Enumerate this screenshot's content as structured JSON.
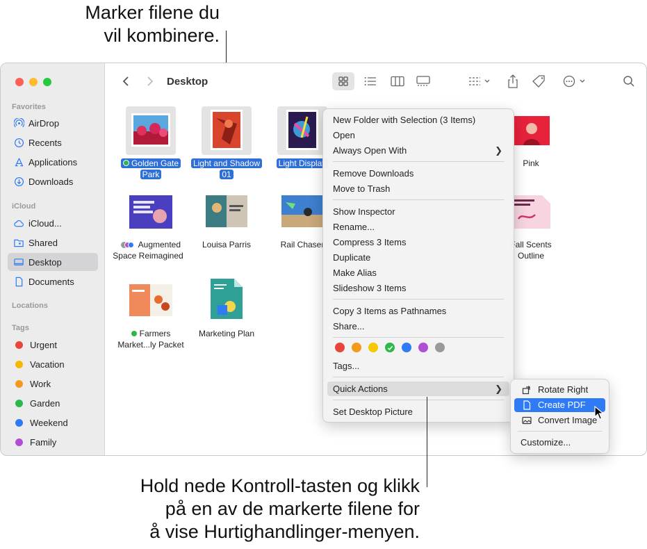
{
  "callouts": {
    "top_line1": "Marker filene du",
    "top_line2": "vil kombinere.",
    "bottom_line1": "Hold nede Kontroll-tasten og klikk",
    "bottom_line2": "på en av de markerte filene for",
    "bottom_line3": "å vise Hurtighandlinger-menyen."
  },
  "window": {
    "title": "Desktop"
  },
  "sidebar": {
    "favorites_header": "Favorites",
    "favorites": [
      {
        "label": "AirDrop",
        "icon": "airdrop-icon"
      },
      {
        "label": "Recents",
        "icon": "clock-icon"
      },
      {
        "label": "Applications",
        "icon": "applications-icon"
      },
      {
        "label": "Downloads",
        "icon": "download-icon"
      }
    ],
    "icloud_header": "iCloud",
    "icloud": [
      {
        "label": "iCloud...",
        "icon": "cloud-icon"
      },
      {
        "label": "Shared",
        "icon": "shared-folder-icon"
      },
      {
        "label": "Desktop",
        "icon": "desktop-icon",
        "selected": true
      },
      {
        "label": "Documents",
        "icon": "document-icon"
      }
    ],
    "locations_header": "Locations",
    "tags_header": "Tags",
    "tags": [
      {
        "label": "Urgent",
        "color": "#e8453c"
      },
      {
        "label": "Vacation",
        "color": "#f5b800"
      },
      {
        "label": "Work",
        "color": "#f39a1e"
      },
      {
        "label": "Garden",
        "color": "#2fb84a"
      },
      {
        "label": "Weekend",
        "color": "#2f7bf5"
      },
      {
        "label": "Family",
        "color": "#b04fd4"
      }
    ]
  },
  "files": {
    "row1": [
      {
        "line1": "Golden Gate",
        "line2": "Park",
        "selected": true
      },
      {
        "line1": "Light and Shadow",
        "line2": "01",
        "selected": true
      },
      {
        "line1": "Light Display",
        "selected": true
      },
      {
        "line1": "Pink"
      }
    ],
    "row2": [
      {
        "line1": "Augmented",
        "line2": "Space Reimagined"
      },
      {
        "line1": "Louisa Parris"
      },
      {
        "line1": "Rail Chaser"
      },
      {
        "line1": "Fall Scents",
        "line2": "Outline"
      }
    ],
    "row3": [
      {
        "line1": "Farmers",
        "line2": "Market...ly Packet"
      },
      {
        "line1": "Marketing Plan"
      }
    ],
    "thumb_text": {
      "augmented": "AUGMENTED SPACE REIMAGINED",
      "louisa": "LOUISA PARRIS",
      "fall": "SIGNATURE SCENTS",
      "marketing": "Marketing Plan Fall 2019",
      "farmers": "Farmers Market"
    }
  },
  "context_menu": {
    "items_group1": [
      "New Folder with Selection (3 Items)",
      "Open",
      "Always Open With"
    ],
    "items_group2": [
      "Remove Downloads",
      "Move to Trash"
    ],
    "items_group3": [
      "Show Inspector",
      "Rename...",
      "Compress 3 Items",
      "Duplicate",
      "Make Alias",
      "Slideshow 3 Items"
    ],
    "items_group4": [
      "Copy 3 Items as Pathnames",
      "Share..."
    ],
    "tag_colors": [
      "#e8453c",
      "#f39a1e",
      "#f5c800",
      "#2fb84a",
      "#2f7bf5",
      "#b04fd4",
      "#9a9a9a"
    ],
    "tags_item": "Tags...",
    "quick_actions": "Quick Actions",
    "set_desktop": "Set Desktop Picture"
  },
  "submenu": {
    "rotate": "Rotate Right",
    "create_pdf": "Create PDF",
    "convert": "Convert Image",
    "customize": "Customize..."
  }
}
